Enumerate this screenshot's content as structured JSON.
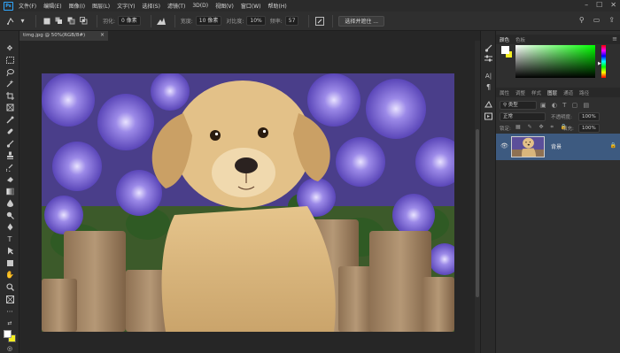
{
  "app": {
    "logo": "Ps"
  },
  "menu": [
    "文件(F)",
    "编辑(E)",
    "图像(I)",
    "图层(L)",
    "文字(Y)",
    "选择(S)",
    "滤镜(T)",
    "3D(D)",
    "视图(V)",
    "窗口(W)",
    "帮助(H)"
  ],
  "window_controls": {
    "minimize": "–",
    "maximize": "☐",
    "close": "✕"
  },
  "options": {
    "feather_label": "羽化:",
    "feather_value": "0 像素",
    "width_label": "宽度:",
    "width_value": "10 像素",
    "contrast_label": "对比度:",
    "contrast_value": "10%",
    "frequency_label": "频率:",
    "frequency_value": "57",
    "select_mask_label": "选择并遮住 ..."
  },
  "document": {
    "tab_label": "timg.jpg @ 50%(RGB/8#)",
    "close": "×"
  },
  "panels": {
    "color_tabs": [
      "颜色",
      "色板"
    ],
    "layer_tabs": [
      "属性",
      "调整",
      "样式",
      "图层",
      "通道",
      "路径"
    ],
    "layer_search": "类型",
    "blend_mode": "正常",
    "opacity_label": "不透明度:",
    "opacity_value": "100%",
    "lock_label": "锁定:",
    "fill_label": "填充:",
    "fill_value": "100%",
    "layer_name": "背景"
  },
  "colors": {
    "foreground": "#ffffff",
    "background": "#f3ee23",
    "layer_selected": "#3d5a80"
  },
  "icons": [
    "move-icon",
    "marquee-icon",
    "lasso-icon",
    "magic-wand-icon",
    "crop-icon",
    "eyedropper-icon",
    "healing-brush-icon",
    "brush-icon",
    "stamp-icon",
    "history-brush-icon",
    "eraser-icon",
    "gradient-icon",
    "blur-icon",
    "dodge-icon",
    "pen-icon",
    "type-icon",
    "path-select-icon",
    "shape-icon",
    "hand-icon",
    "zoom-icon",
    "more-icon"
  ]
}
